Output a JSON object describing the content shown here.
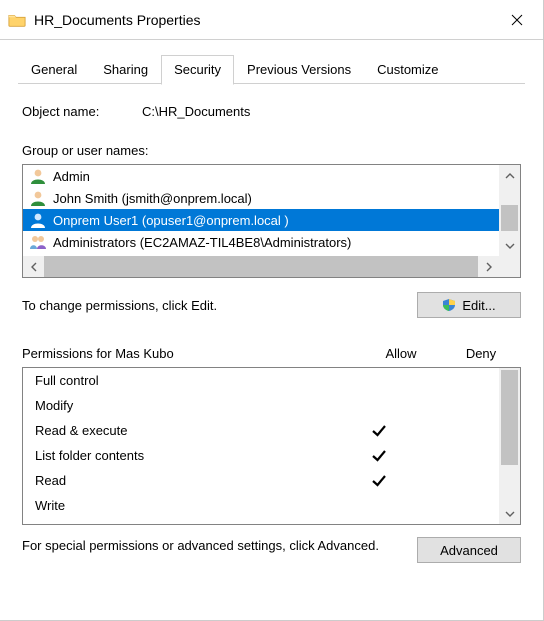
{
  "window": {
    "title": "HR_Documents Properties"
  },
  "tabs": {
    "general": "General",
    "sharing": "Sharing",
    "security": "Security",
    "previous": "Previous Versions",
    "customize": "Customize"
  },
  "security": {
    "object_name_label": "Object name:",
    "object_name_value": "C:\\HR_Documents",
    "group_label": "Group or user names:",
    "principals": [
      {
        "display": "Admin",
        "kind": "user",
        "selected": false
      },
      {
        "display": "John Smith (jsmith@onprem.local)",
        "kind": "user",
        "selected": false
      },
      {
        "display": "Onprem User1 (opuser1@onprem.local )",
        "kind": "user",
        "selected": true
      },
      {
        "display": "Administrators (EC2AMAZ-TIL4BE8\\Administrators)",
        "kind": "group",
        "selected": false
      }
    ],
    "change_hint": "To change permissions, click Edit.",
    "edit_button": "Edit...",
    "perms_for_label": "Permissions for Mas Kubo",
    "allow_label": "Allow",
    "deny_label": "Deny",
    "permissions": [
      {
        "name": "Full control",
        "allow": false,
        "deny": false
      },
      {
        "name": "Modify",
        "allow": false,
        "deny": false
      },
      {
        "name": "Read & execute",
        "allow": true,
        "deny": false
      },
      {
        "name": "List folder contents",
        "allow": true,
        "deny": false
      },
      {
        "name": "Read",
        "allow": true,
        "deny": false
      },
      {
        "name": "Write",
        "allow": false,
        "deny": false
      }
    ],
    "advanced_hint": "For special permissions or advanced settings, click Advanced.",
    "advanced_button": "Advanced"
  }
}
